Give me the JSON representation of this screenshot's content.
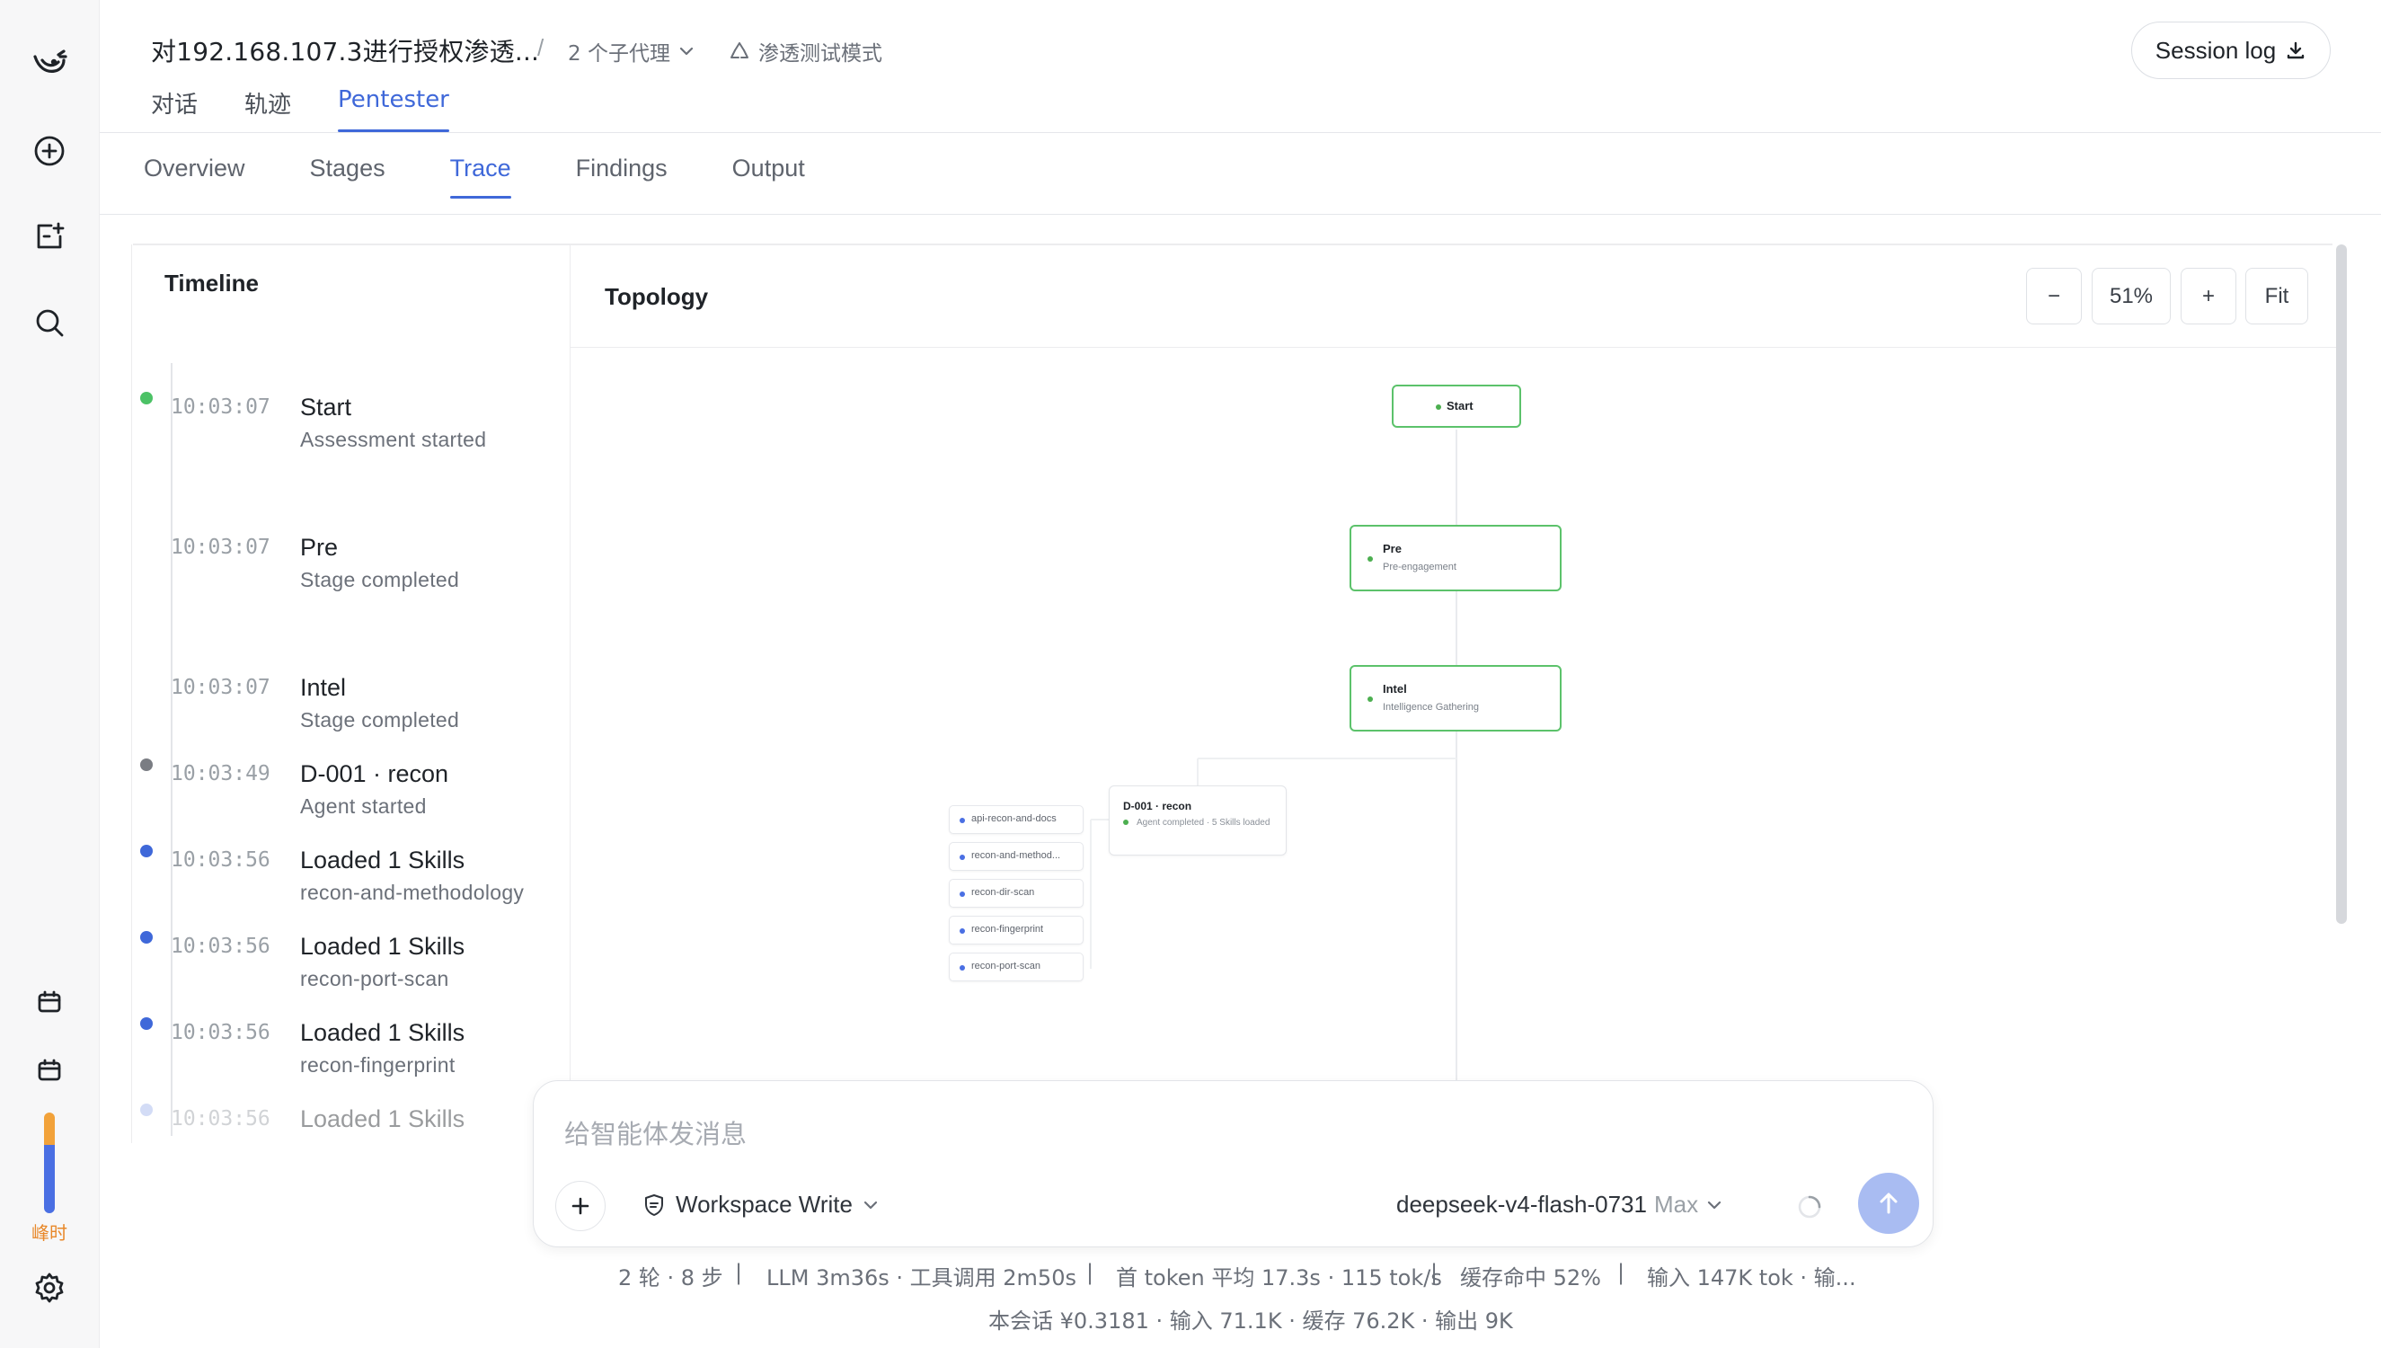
{
  "window": {
    "title": "对192.168.107.3进行授权渗透...",
    "subagents_label": "2 个子代理",
    "mode_label": "渗透测试模式",
    "session_log_label": "Session log"
  },
  "rail": {
    "items": [
      "logo-icon",
      "new-chat-icon",
      "new-project-icon",
      "search-icon",
      "calendar-icon",
      "calendar-icon",
      "settings-icon"
    ],
    "peak_label": "峰时",
    "usage_level": 0.32
  },
  "top_tabs": [
    {
      "label": "对话",
      "active": false
    },
    {
      "label": "轨迹",
      "active": false
    },
    {
      "label": "Pentester",
      "active": true
    }
  ],
  "sub_tabs": [
    {
      "label": "Overview",
      "active": false
    },
    {
      "label": "Stages",
      "active": false
    },
    {
      "label": "Trace",
      "active": true
    },
    {
      "label": "Findings",
      "active": false
    },
    {
      "label": "Output",
      "active": false
    }
  ],
  "timeline": {
    "title": "Timeline",
    "items": [
      {
        "time": "10:03:07",
        "name": "Start",
        "desc": "Assessment started",
        "dot": "#4cc266"
      },
      {
        "time": "10:03:07",
        "name": "Pre",
        "desc": "Stage completed",
        "dot": ""
      },
      {
        "time": "10:03:07",
        "name": "Intel",
        "desc": "Stage completed",
        "dot": ""
      },
      {
        "time": "10:03:49",
        "name": "D-001 · recon",
        "desc": "Agent started",
        "dot": "#7a7d83"
      },
      {
        "time": "10:03:56",
        "name": "Loaded 1 Skills",
        "desc": "recon-and-methodology",
        "dot": "#3f68d9"
      },
      {
        "time": "10:03:56",
        "name": "Loaded 1 Skills",
        "desc": "recon-port-scan",
        "dot": "#3f68d9"
      },
      {
        "time": "10:03:56",
        "name": "Loaded 1 Skills",
        "desc": "recon-fingerprint",
        "dot": "#3f68d9"
      },
      {
        "time": "10:03:56",
        "name": "Loaded 1 Skills",
        "desc": "",
        "dot": "#9fb2ec"
      }
    ]
  },
  "topology": {
    "title": "Topology",
    "zoom_out": "−",
    "zoom_level": "51%",
    "zoom_in": "+",
    "fit": "Fit",
    "nodes": {
      "start": {
        "name": "Start"
      },
      "pre": {
        "name": "Pre",
        "sub": "Pre-engagement"
      },
      "intel": {
        "name": "Intel",
        "sub": "Intelligence Gathering"
      },
      "agent": {
        "name": "D-001 · recon",
        "sub": "Agent completed · 5 Skills loaded"
      }
    },
    "skills": [
      "api-recon-and-docs",
      "recon-and-method...",
      "recon-dir-scan",
      "recon-fingerprint",
      "recon-port-scan"
    ]
  },
  "composer": {
    "placeholder": "给智能体发消息",
    "permission": "Workspace Write",
    "model": "deepseek-v4-flash-0731",
    "effort": "Max"
  },
  "stats": {
    "line1": [
      "2 轮 · 8 步",
      "LLM 3m36s · 工具调用 2m50s",
      "首 token 平均 17.3s · 115 tok/s",
      "缓存命中 52%",
      "输入 147K tok · 输..."
    ],
    "separator": "|",
    "line2": "本会话 ¥0.3181 · 输入 71.1K · 缓存 76.2K · 输出 9K"
  },
  "colors": {
    "accent": "#3f68d9",
    "success": "#5cc26b",
    "usage_top": "#f2a23a",
    "usage_bottom": "#4a6fe3"
  }
}
